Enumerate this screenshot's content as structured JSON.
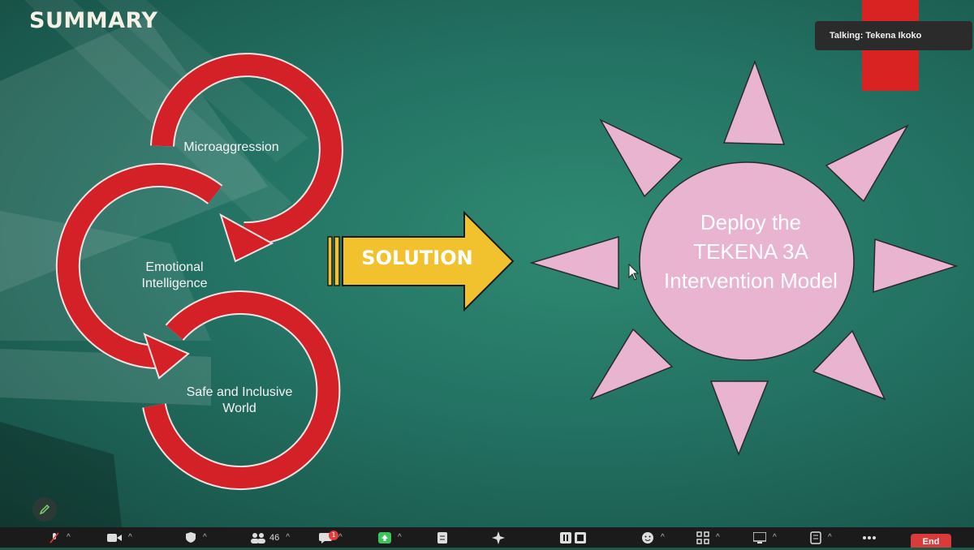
{
  "slide": {
    "title": "SUMMARY",
    "loop_labels": [
      "Microaggression",
      "Emotional Intelligence",
      "Safe and Inclusive World"
    ],
    "arrow_label": "SOLUTION",
    "center_text": "Deploy the TEKENA 3A Intervention Model",
    "colors": {
      "loop_red": "#d42027",
      "arrow_yellow": "#f2c12e",
      "sun_pink": "#e8b4cf",
      "background": "#237263"
    }
  },
  "meeting": {
    "talking_indicator": "Talking: Tekena Ikoko",
    "participants_count": "46",
    "chat_badge": "1",
    "end_button": "End"
  },
  "toolbar_icons": [
    "mic-muted-icon",
    "video-icon",
    "security-icon",
    "participants-icon",
    "chat-icon",
    "share-screen-icon",
    "notes-icon",
    "ai-companion-icon",
    "recording-icon",
    "reactions-icon",
    "apps-icon",
    "view-icon",
    "whiteboard-icon",
    "more-icon"
  ]
}
